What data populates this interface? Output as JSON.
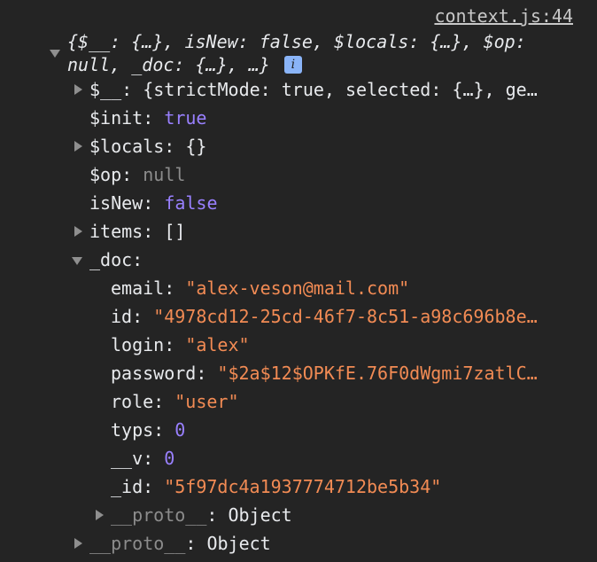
{
  "source_link": "context.js:44",
  "summary": {
    "line1": "{$__: {…}, isNew: false, $locals: {…}, $op:",
    "line2": "null, _doc: {…}, …}",
    "info_icon_label": "i"
  },
  "props": {
    "dollar_underscore": {
      "key": "$__",
      "value": "{strictMode: true, selected: {…}, ge…"
    },
    "init": {
      "key": "$init",
      "value": "true"
    },
    "locals": {
      "key": "$locals",
      "value": "{}"
    },
    "op": {
      "key": "$op",
      "value": "null"
    },
    "isNew": {
      "key": "isNew",
      "value": "false"
    },
    "items": {
      "key": "items",
      "value": "[]"
    },
    "doc": {
      "key": "_doc",
      "value": ""
    }
  },
  "doc_fields": {
    "email": {
      "key": "email",
      "value": "\"alex-veson@mail.com\""
    },
    "id": {
      "key": "id",
      "value": "\"4978cd12-25cd-46f7-8c51-a98c696b8e…"
    },
    "login": {
      "key": "login",
      "value": "\"alex\""
    },
    "password": {
      "key": "password",
      "value": "\"$2a$12$OPKfE.76F0dWgmi7zatlC…"
    },
    "role": {
      "key": "role",
      "value": "\"user\""
    },
    "typs": {
      "key": "typs",
      "value": "0"
    },
    "v": {
      "key": "__v",
      "value": "0"
    },
    "_id": {
      "key": "_id",
      "value": "\"5f97dc4a1937774712be5b34\""
    },
    "proto": {
      "key": "__proto__",
      "value": "Object"
    }
  },
  "outer_proto": {
    "key": "__proto__",
    "value": "Object"
  }
}
